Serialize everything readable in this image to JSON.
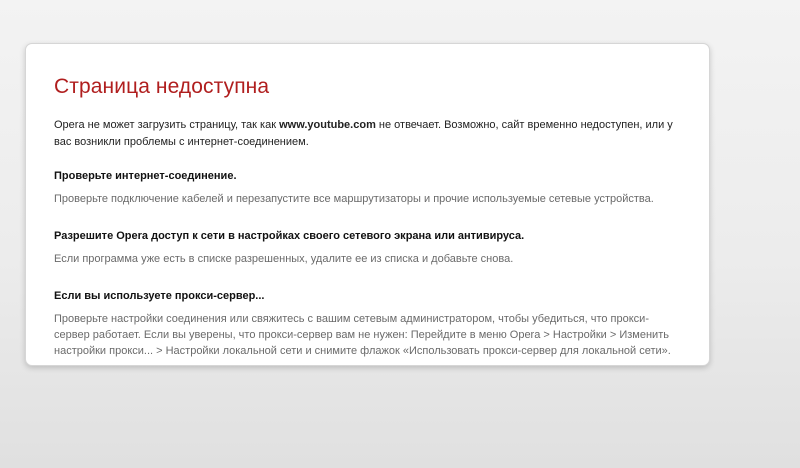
{
  "error": {
    "title": "Страница недоступна",
    "intro_prefix": "Opera не может загрузить страницу, так как ",
    "site": "www.youtube.com",
    "intro_suffix": " не отвечает. Возможно, сайт временно недоступен, или у вас возникли проблемы с интернет-соединением.",
    "sections": [
      {
        "heading": "Проверьте интернет-соединение.",
        "text": "Проверьте подключение кабелей и перезапустите все маршрутизаторы и прочие используемые сетевые устройства."
      },
      {
        "heading": "Разрешите Opera доступ к сети в настройках своего сетевого экрана или антивируса.",
        "text": "Если программа уже есть в списке разрешенных, удалите ее из списка и добавьте снова."
      },
      {
        "heading": "Если вы используете прокси-сервер...",
        "text": "Проверьте настройки соединения или свяжитесь с вашим сетевым администратором, чтобы убедиться, что прокси-сервер работает. Если вы уверены, что прокси-сервер вам не нужен: Перейдите в меню Opera > Настройки > Изменить настройки прокси... > Настройки локальной сети и снимите флажок «Использовать прокси-сервер для локальной сети»."
      }
    ]
  },
  "colors": {
    "title": "#b01e1e",
    "body_text": "#222222",
    "muted_text": "#6a6a6a",
    "card_bg": "#ffffff"
  }
}
